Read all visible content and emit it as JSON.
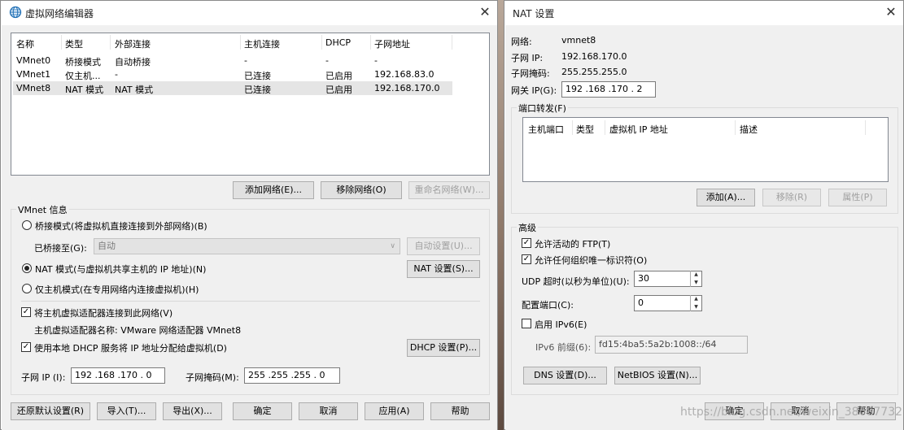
{
  "vne": {
    "title": "虚拟网络编辑器",
    "close": "✕",
    "columns": [
      "名称",
      "类型",
      "外部连接",
      "主机连接",
      "DHCP",
      "子网地址"
    ],
    "rows": [
      [
        "VMnet0",
        "桥接模式",
        "自动桥接",
        "-",
        "-",
        "-"
      ],
      [
        "VMnet1",
        "仅主机...",
        "-",
        "已连接",
        "已启用",
        "192.168.83.0"
      ],
      [
        "VMnet8",
        "NAT 模式",
        "NAT 模式",
        "已连接",
        "已启用",
        "192.168.170.0"
      ]
    ],
    "add_network": "添加网络(E)...",
    "remove_network": "移除网络(O)",
    "rename_network": "重命名网络(W)...",
    "vmnet_info": "VMnet 信息",
    "bridged_mode": "桥接模式(将虚拟机直接连接到外部网络)(B)",
    "bridged_to_label": "已桥接至(G):",
    "bridged_to_value": "自动",
    "auto_settings": "自动设置(U)...",
    "nat_mode": "NAT 模式(与虚拟机共享主机的 IP 地址)(N)",
    "nat_settings": "NAT 设置(S)...",
    "host_only_mode": "仅主机模式(在专用网络内连接虚拟机)(H)",
    "connect_adapter": "将主机虚拟适配器连接到此网络(V)",
    "adapter_name": "主机虚拟适配器名称: VMware 网络适配器 VMnet8",
    "use_dhcp": "使用本地 DHCP 服务将 IP 地址分配给虚拟机(D)",
    "dhcp_settings": "DHCP 设置(P)...",
    "subnet_ip_label": "子网 IP (I):",
    "subnet_ip_value": "192 .168 .170 . 0",
    "subnet_mask_label": "子网掩码(M):",
    "subnet_mask_value": "255 .255 .255 . 0",
    "restore_defaults": "还原默认设置(R)",
    "import": "导入(T)...",
    "export": "导出(X)...",
    "ok": "确定",
    "cancel": "取消",
    "apply": "应用(A)",
    "help": "帮助"
  },
  "nat": {
    "title": "NAT 设置",
    "close": "✕",
    "network_label": "网络:",
    "network_value": "vmnet8",
    "subnet_ip_label": "子网 IP:",
    "subnet_ip_value": "192.168.170.0",
    "subnet_mask_label": "子网掩码:",
    "subnet_mask_value": "255.255.255.0",
    "gateway_label": "网关 IP(G):",
    "gateway_value": "192 .168 .170 . 2",
    "port_forwarding": "端口转发(F)",
    "pf_columns": [
      "主机端口",
      "类型",
      "虚拟机 IP 地址",
      "描述"
    ],
    "add": "添加(A)...",
    "remove": "移除(R)",
    "properties": "属性(P)",
    "advanced": "高级",
    "allow_ftp": "允许活动的 FTP(T)",
    "allow_oui": "允许任何组织唯一标识符(O)",
    "udp_timeout_label": "UDP 超时(以秒为单位)(U):",
    "udp_timeout_value": "30",
    "config_port_label": "配置端口(C):",
    "config_port_value": "0",
    "enable_ipv6": "启用 IPv6(E)",
    "ipv6_prefix_label": "IPv6 前缀(6):",
    "ipv6_prefix_value": "fd15:4ba5:5a2b:1008::/64",
    "dns_settings": "DNS 设置(D)...",
    "netbios_settings": "NetBIOS 设置(N)...",
    "ok": "确定",
    "cancel": "取消",
    "help": "帮助",
    "watermark": "https://blog.csdn.net/weixin_38687732"
  }
}
